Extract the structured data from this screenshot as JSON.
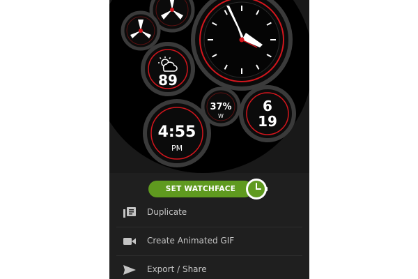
{
  "watchface": {
    "weather_temp": "89",
    "time": "4:55",
    "ampm": "PM",
    "humidity_value": "37%",
    "humidity_unit": "W",
    "date_top": "6",
    "date_bottom": "19",
    "icons": {
      "weather": "partly-cloudy-icon",
      "spinners": "spinner-icon"
    }
  },
  "actions": {
    "set_watchface_label": "SET WATCHFACE"
  },
  "menu": {
    "items": [
      {
        "label": "Duplicate",
        "icon": "duplicate-icon"
      },
      {
        "label": "Create Animated GIF",
        "icon": "video-camera-icon"
      },
      {
        "label": "Export / Share",
        "icon": "share-icon"
      }
    ]
  },
  "colors": {
    "accent_green": "#5f9a1f",
    "accent_red": "#d4161d",
    "panel_bg": "#1f1f1f"
  }
}
